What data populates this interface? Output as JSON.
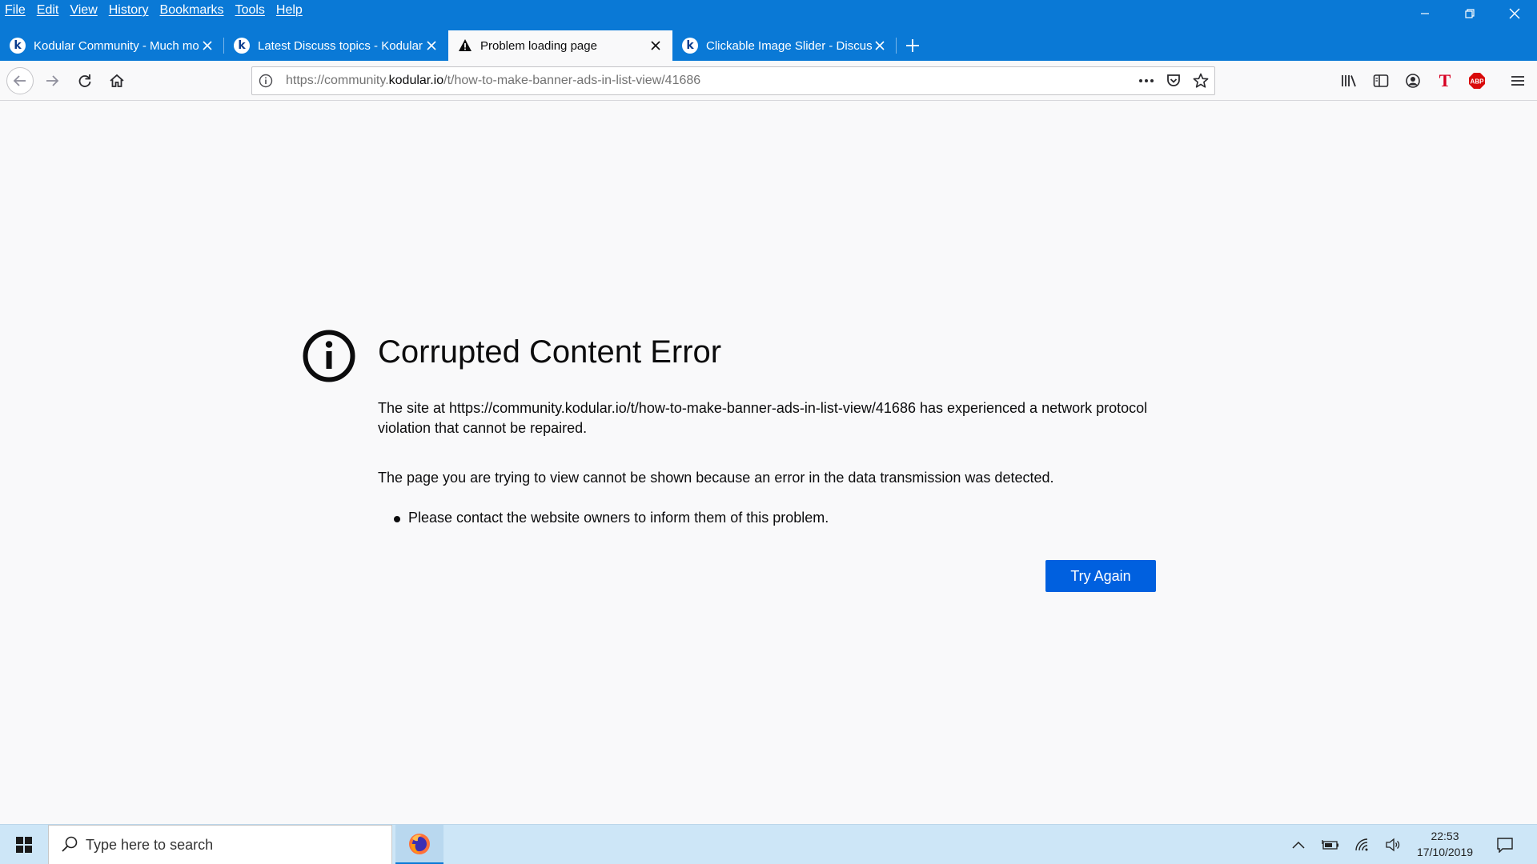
{
  "menu": [
    "File",
    "Edit",
    "View",
    "History",
    "Bookmarks",
    "Tools",
    "Help"
  ],
  "tabs": [
    {
      "title": "Kodular Community - Much mo",
      "favicon": "kodular-k-icon",
      "active": false
    },
    {
      "title": "Latest Discuss topics - Kodular",
      "favicon": "kodular-k-icon",
      "active": false
    },
    {
      "title": "Problem loading page",
      "favicon": "warning-icon",
      "active": true
    },
    {
      "title": "Clickable Image Slider - Discus",
      "favicon": "kodular-k-icon",
      "active": false
    }
  ],
  "url": {
    "prefix": "https://community.",
    "domain": "kodular.io",
    "path": "/t/how-to-make-banner-ads-in-list-view/41686"
  },
  "error": {
    "title": "Corrupted Content Error",
    "paragraph1": "The site at https://community.kodular.io/t/how-to-make-banner-ads-in-list-view/41686 has experienced a network protocol violation that cannot be repaired.",
    "paragraph2": "The page you are trying to view cannot be shown because an error in the data transmission was detected.",
    "bullets": [
      "Please contact the website owners to inform them of this problem."
    ],
    "button": "Try Again"
  },
  "taskbar": {
    "search_placeholder": "Type here to search",
    "time": "22:53",
    "date": "17/10/2019"
  },
  "colors": {
    "titlebar": "#0a79d6",
    "accent_button": "#0060df",
    "page_bg": "#f9f9fa",
    "taskbar": "#cde6f7",
    "abp": "#d90a0a"
  }
}
